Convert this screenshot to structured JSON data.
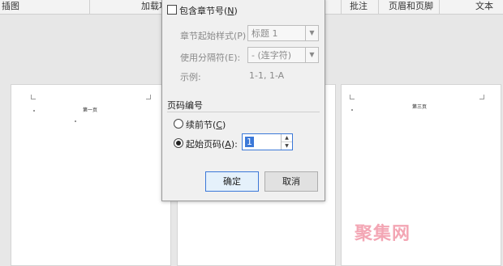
{
  "ribbon": {
    "insert_image": "插图",
    "addins": "加载项",
    "comments": "批注",
    "header_footer": "页眉和页脚",
    "text": "文本"
  },
  "pages": {
    "page1_title": "第一页",
    "page3_title": "第三页"
  },
  "dialog": {
    "include_chapter": {
      "label": "包含章节号",
      "shortcut": "N"
    },
    "chapter_style": {
      "label": "章节起始样式(P)",
      "value": "标题 1"
    },
    "separator": {
      "label": "使用分隔符(E):",
      "value": "-  (连字符)"
    },
    "example": {
      "label": "示例:",
      "value": "1-1, 1-A"
    },
    "numbering_section": "页码编号",
    "continue_prev": {
      "label": "续前节",
      "shortcut": "C"
    },
    "start_at": {
      "label": "起始页码",
      "shortcut": "A",
      "value": "1"
    },
    "ok": "确定",
    "cancel": "取消"
  },
  "watermark": "聚集网"
}
